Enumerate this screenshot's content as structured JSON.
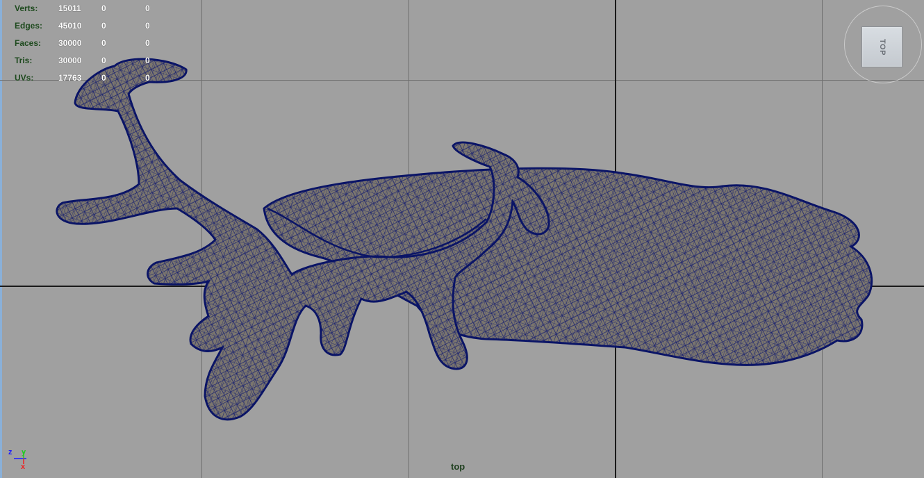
{
  "viewport": {
    "view_name": "top",
    "background": "#a0a0a0",
    "wire_color": "#0f1a70",
    "shade_color": "#7a756c"
  },
  "hud": {
    "rows": [
      {
        "label": "Verts:",
        "v1": "15011",
        "v2": "0",
        "v3": "0"
      },
      {
        "label": "Edges:",
        "v1": "45010",
        "v2": "0",
        "v3": "0"
      },
      {
        "label": "Faces:",
        "v1": "30000",
        "v2": "0",
        "v3": "0"
      },
      {
        "label": "Tris:",
        "v1": "30000",
        "v2": "0",
        "v3": "0"
      },
      {
        "label": "UVs:",
        "v1": "17763",
        "v2": "0",
        "v3": "0"
      }
    ]
  },
  "viewcube": {
    "face_label": "TOP"
  },
  "axis_gizmo": {
    "z_label": "z",
    "y_label": "y",
    "x_label": "x",
    "z_color": "#1a1aff",
    "y_color": "#22cc22",
    "x_color": "#ee2222"
  }
}
